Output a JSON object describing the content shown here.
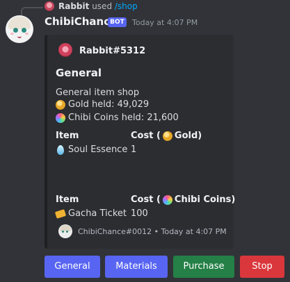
{
  "reply": {
    "user": "Rabbit",
    "used_text": "used",
    "command": "/shop"
  },
  "message": {
    "username": "ChibiChance",
    "bot_tag": "BOT",
    "timestamp": "Today at 4:07 PM"
  },
  "embed": {
    "author": "Rabbit#5312",
    "title": "General",
    "description": {
      "line1": "General item shop",
      "gold_held": "Gold held: 49,029",
      "chibi_held": "Chibi Coins held: 21,600"
    },
    "section1": {
      "item_header": "Item",
      "cost_header_prefix": "Cost (",
      "cost_header_currency": "Gold)",
      "item": "Soul Essence",
      "cost": "1"
    },
    "section2": {
      "item_header": "Item",
      "cost_header_prefix": "Cost (",
      "cost_header_currency": "Chibi Coins)",
      "item": "Gacha Ticket",
      "cost": "100"
    },
    "footer": "ChibiChance#0012 • Today at 4:07 PM"
  },
  "buttons": {
    "general": "General",
    "materials": "Materials",
    "purchase": "Purchase",
    "stop": "Stop"
  },
  "colors": {
    "background": "#313338",
    "embed_bg": "#2b2d31",
    "blurple": "#5865f2",
    "green": "#248046",
    "red": "#da373c",
    "link": "#00a8fc"
  }
}
